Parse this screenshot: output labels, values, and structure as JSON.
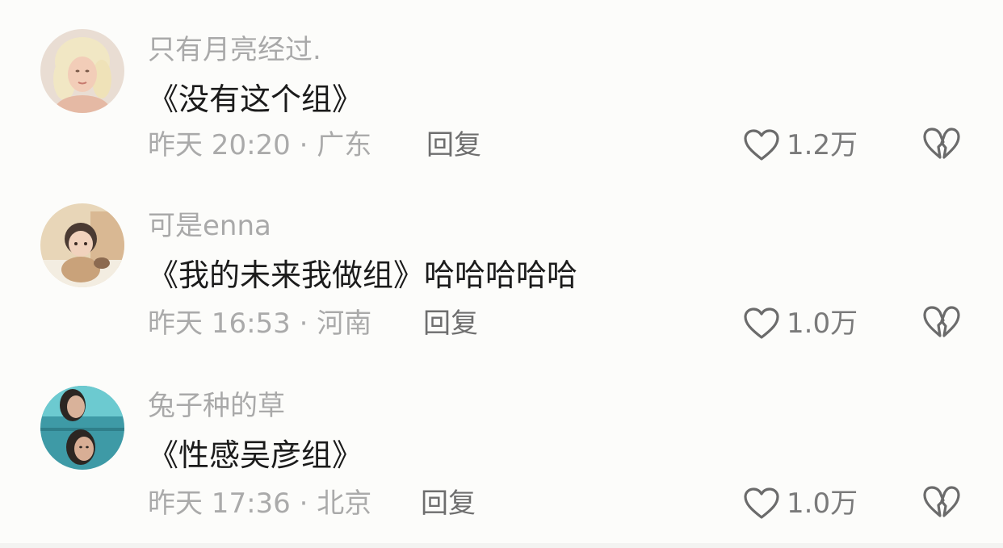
{
  "comments": [
    {
      "username": "只有月亮经过.",
      "text": "《没有这个组》",
      "meta": "昨天 20:20 · 广东",
      "reply_label": "回复",
      "likes": "1.2万",
      "avatar_colors": [
        "#e9ddd3",
        "#f1e7c4",
        "#e5b9a4"
      ]
    },
    {
      "username": "可是enna",
      "text": "《我的未来我做组》哈哈哈哈哈",
      "meta": "昨天 16:53 · 河南",
      "reply_label": "回复",
      "likes": "1.0万",
      "avatar_colors": [
        "#e8d6b8",
        "#c9a27a",
        "#8c6a50"
      ]
    },
    {
      "username": "兔子种的草",
      "text": "《性感吴彦组》",
      "meta": "昨天 17:36 · 北京",
      "reply_label": "回复",
      "likes": "1.0万",
      "avatar_colors": [
        "#3e9aa6",
        "#6ccad0",
        "#2c2622"
      ]
    }
  ],
  "icons": {
    "like": "heart-outline-icon",
    "dislike": "broken-heart-icon"
  },
  "colors": {
    "username": "#a9a9a9",
    "text": "#1b1b1b",
    "meta": "#aaaaaa",
    "icon": "#6b6b6b"
  }
}
